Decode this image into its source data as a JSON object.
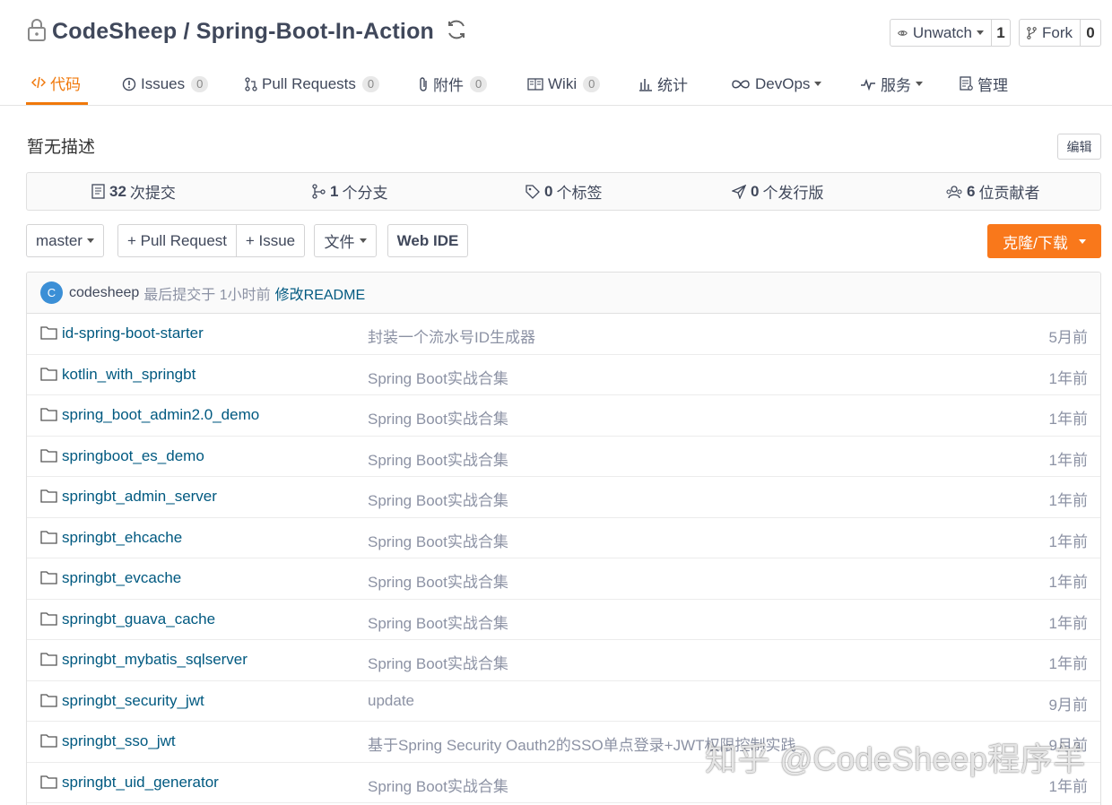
{
  "repo": {
    "title": "CodeSheep / Spring-Boot-In-Action",
    "watch_label": "Unwatch",
    "watch_count": "1",
    "fork_label": "Fork",
    "fork_count": "0"
  },
  "tabs": [
    {
      "label": "代码",
      "icon": "code-icon",
      "badge": null,
      "active": true
    },
    {
      "label": "Issues",
      "icon": "issue-icon",
      "badge": "0"
    },
    {
      "label": "Pull Requests",
      "icon": "pull-request-icon",
      "badge": "0"
    },
    {
      "label": "附件",
      "icon": "paperclip-icon",
      "badge": "0"
    },
    {
      "label": "Wiki",
      "icon": "book-icon",
      "badge": "0"
    },
    {
      "label": "统计",
      "icon": "bar-chart-icon",
      "badge": null
    },
    {
      "label": "DevOps",
      "icon": "infinity-icon",
      "badge": null,
      "dropdown": true
    },
    {
      "label": "服务",
      "icon": "pulse-icon",
      "badge": null,
      "dropdown": true
    },
    {
      "label": "管理",
      "icon": "settings-doc-icon",
      "badge": null
    }
  ],
  "description": {
    "text": "暂无描述",
    "edit_label": "编辑"
  },
  "stats": {
    "commits_count": "32",
    "commits_label": "次提交",
    "branches_count": "1",
    "branches_label": "个分支",
    "tags_count": "0",
    "tags_label": "个标签",
    "releases_count": "0",
    "releases_label": "个发行版",
    "contributors_count": "6",
    "contributors_label": "位贡献者"
  },
  "toolbar": {
    "branch": "master",
    "pull_request": "+ Pull Request",
    "issue": "+ Issue",
    "file": "文件",
    "web_ide": "Web IDE",
    "clone": "克隆/下载"
  },
  "last_commit": {
    "avatar_letter": "C",
    "author": "codesheep",
    "meta": "最后提交于 1小时前",
    "message": "修改README"
  },
  "files": [
    {
      "name": "id-spring-boot-starter",
      "message": "封装一个流水号ID生成器",
      "time": "5月前"
    },
    {
      "name": "kotlin_with_springbt",
      "message": "Spring Boot实战合集",
      "time": "1年前"
    },
    {
      "name": "spring_boot_admin2.0_demo",
      "message": "Spring Boot实战合集",
      "time": "1年前"
    },
    {
      "name": "springboot_es_demo",
      "message": "Spring Boot实战合集",
      "time": "1年前"
    },
    {
      "name": "springbt_admin_server",
      "message": "Spring Boot实战合集",
      "time": "1年前"
    },
    {
      "name": "springbt_ehcache",
      "message": "Spring Boot实战合集",
      "time": "1年前"
    },
    {
      "name": "springbt_evcache",
      "message": "Spring Boot实战合集",
      "time": "1年前"
    },
    {
      "name": "springbt_guava_cache",
      "message": "Spring Boot实战合集",
      "time": "1年前"
    },
    {
      "name": "springbt_mybatis_sqlserver",
      "message": "Spring Boot实战合集",
      "time": "1年前"
    },
    {
      "name": "springbt_security_jwt",
      "message": "update",
      "time": "9月前"
    },
    {
      "name": "springbt_sso_jwt",
      "message": "基于Spring Security Oauth2的SSO单点登录+JWT权限控制实践",
      "time": "9月前"
    },
    {
      "name": "springbt_uid_generator",
      "message": "Spring Boot实战合集",
      "time": "1年前"
    }
  ],
  "watermark": "知乎 @CodeSheep程序羊",
  "colors": {
    "accent": "#f0780a",
    "clone_button": "#f9781b",
    "link": "#005980",
    "muted": "#8c92a4"
  }
}
